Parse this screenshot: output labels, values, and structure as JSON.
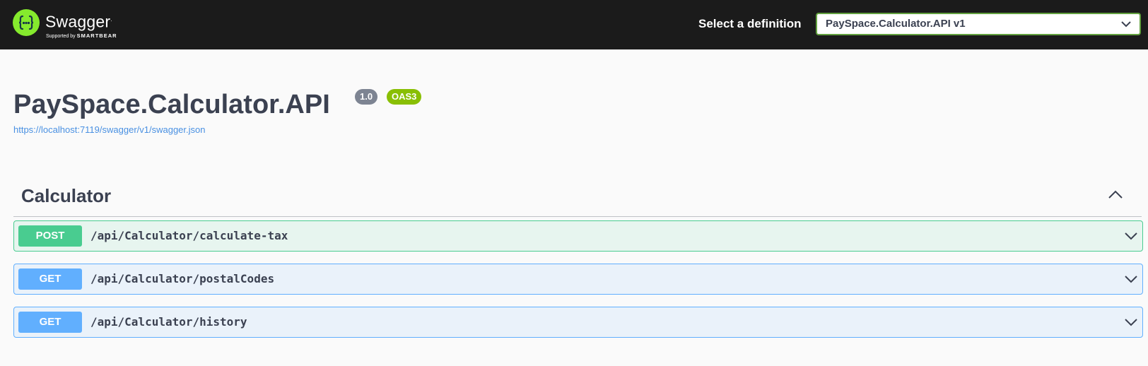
{
  "topbar": {
    "logo_name": "Swagger",
    "logo_tm": ".",
    "logo_sub_prefix": "Supported by",
    "logo_sub_brand": "SMARTBEAR",
    "definition_label": "Select a definition",
    "definition_selected": "PaySpace.Calculator.API v1"
  },
  "info": {
    "title": "PaySpace.Calculator.API",
    "version": "1.0",
    "oas": "OAS3",
    "spec_url": "https://localhost:7119/swagger/v1/swagger.json"
  },
  "tag": {
    "name": "Calculator",
    "operations": [
      {
        "method": "POST",
        "path": "/api/Calculator/calculate-tax"
      },
      {
        "method": "GET",
        "path": "/api/Calculator/postalCodes"
      },
      {
        "method": "GET",
        "path": "/api/Calculator/history"
      }
    ]
  },
  "colors": {
    "topbar": "#1b1b1b",
    "logo": "#85ea2d",
    "post": "#49cc90",
    "get": "#61affe",
    "version_badge": "#7d8492",
    "oas_badge": "#89bf04",
    "link": "#4990e2"
  },
  "icons": {
    "logo": "swagger-braces-icon",
    "select": "chevron-down-icon",
    "tag_toggle": "chevron-up-icon",
    "op_toggle": "chevron-down-icon"
  }
}
